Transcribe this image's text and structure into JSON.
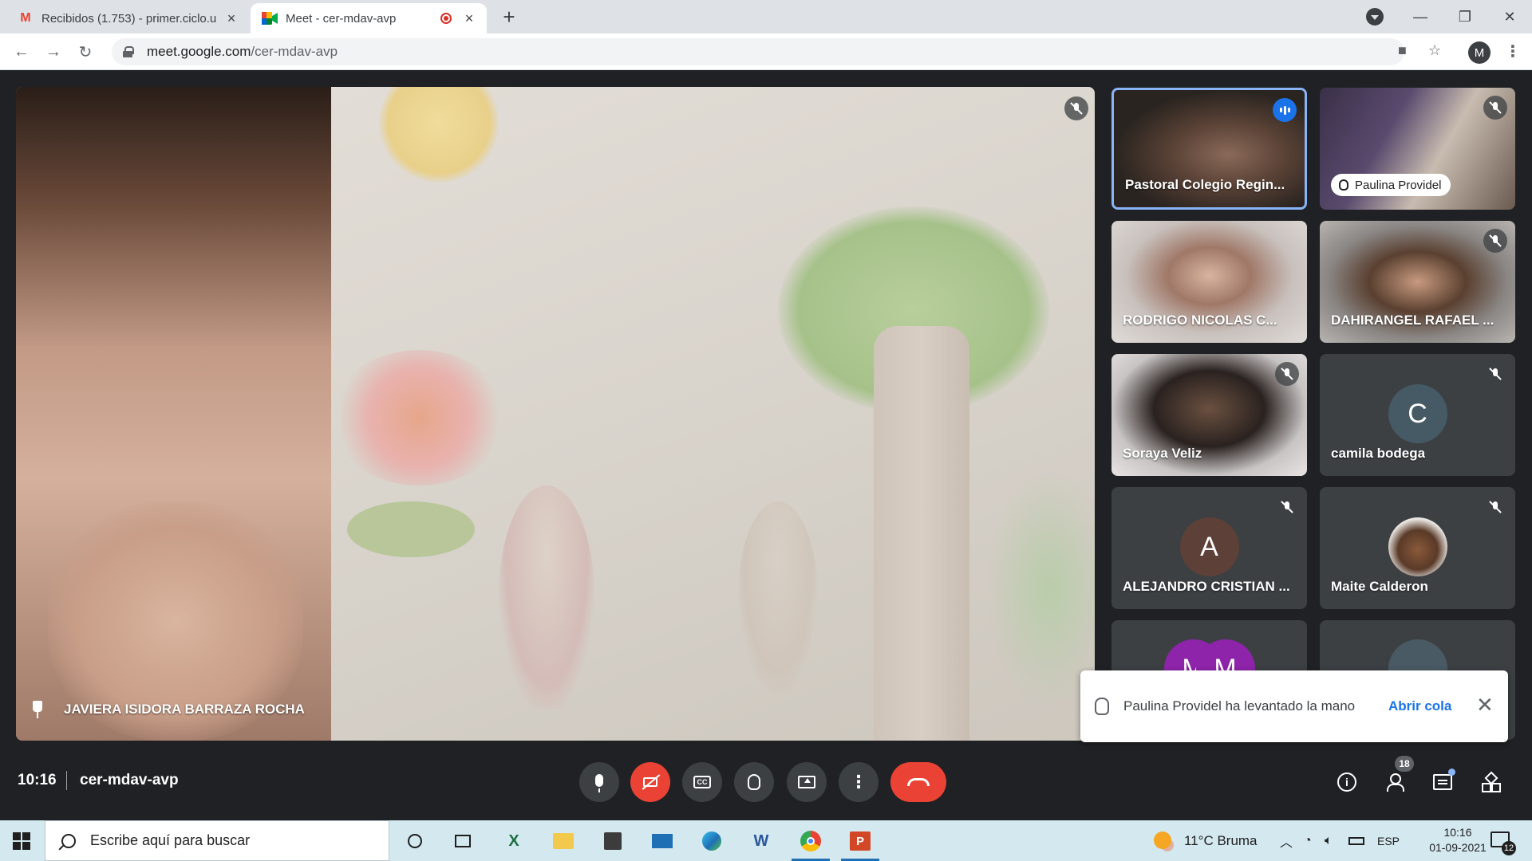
{
  "browser": {
    "tabs": [
      {
        "title": "Recibidos (1.753) - primer.ciclo.u",
        "favicon": "gmail-icon",
        "active": false
      },
      {
        "title": "Meet - cer-mdav-avp",
        "favicon": "meet-icon",
        "active": true
      }
    ],
    "new_tab_label": "+",
    "url_host": "meet.google.com",
    "url_path": "/cer-mdav-avp",
    "profile_initial": "M"
  },
  "meet": {
    "main_participant": "JAVIERA ISIDORA BARRAZA ROCHA",
    "participants": [
      {
        "name": "Pastoral Colegio Regin...",
        "speaking": true,
        "muted": false
      },
      {
        "name": "Paulina Providel",
        "hand_raised": true,
        "muted": true
      },
      {
        "name": "RODRIGO NICOLAS C...",
        "muted": false
      },
      {
        "name": "DAHIRANGEL RAFAEL ...",
        "muted": true
      },
      {
        "name": "Soraya Veliz",
        "muted": true
      },
      {
        "name": "camila bodega",
        "muted": true,
        "avatar_letter": "C",
        "avatar_color": "#455a64"
      },
      {
        "name": "ALEJANDRO CRISTIAN ...",
        "muted": true,
        "avatar_letter": "A",
        "avatar_color": "#5d4037"
      },
      {
        "name": "Maite Calderon",
        "muted": true
      },
      {
        "name": "",
        "avatar_letter": "M",
        "avatar_color": "#8e24aa"
      },
      {
        "name": ""
      }
    ],
    "toast": {
      "message": "Paulina Providel ha levantado la mano",
      "action": "Abrir cola"
    },
    "time": "10:16",
    "meeting_code": "cer-mdav-avp",
    "participant_count": "18",
    "controls": [
      "mic-icon",
      "camera-off-icon",
      "captions-icon",
      "raise-hand-icon",
      "present-icon",
      "more-options-icon",
      "hang-up-icon"
    ],
    "cc_label": "CC",
    "colors": {
      "accent": "#1a73e8",
      "danger": "#ea4335",
      "speaking_border": "#8ab4f8"
    }
  },
  "taskbar": {
    "search_placeholder": "Escribe aquí para buscar",
    "weather": "11°C  Bruma",
    "language": "ESP",
    "time": "10:16",
    "date": "01-09-2021",
    "notifications": "12"
  }
}
